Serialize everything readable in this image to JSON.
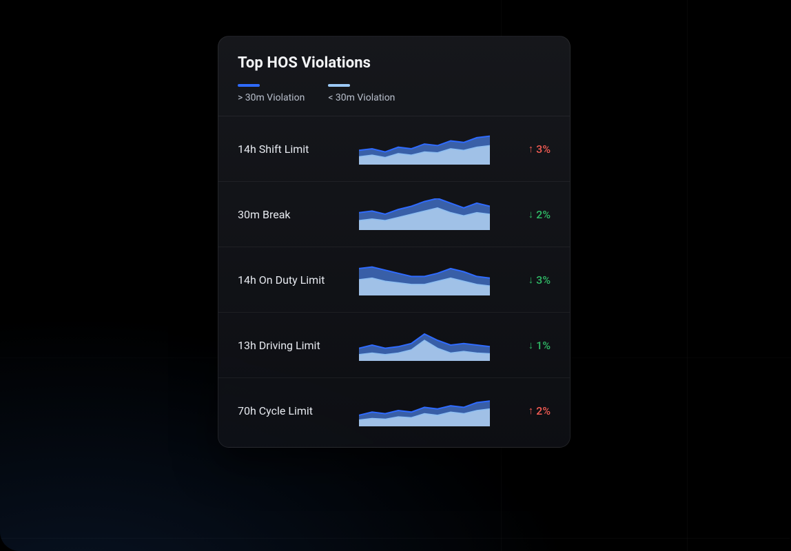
{
  "card": {
    "title": "Top HOS Violations",
    "legend": [
      {
        "swatch": "dark",
        "label": "> 30m Violation"
      },
      {
        "swatch": "light",
        "label": "< 30m Violation"
      }
    ]
  },
  "colors": {
    "series_over_30m_line": "#2f6bff",
    "series_over_30m_fill": "rgba(74,128,230,0.70)",
    "series_under_30m_line": "#8fbef0",
    "series_under_30m_fill": "rgba(190,220,248,0.78)",
    "delta_up": "#ef5a52",
    "delta_down": "#2fb765"
  },
  "rows": [
    {
      "label": "14h Shift Limit",
      "delta": {
        "dir": "up",
        "text": "3%"
      },
      "over": [
        18,
        20,
        16,
        22,
        20,
        26,
        24,
        30,
        28,
        34,
        36
      ],
      "under": [
        10,
        12,
        9,
        14,
        12,
        16,
        15,
        20,
        18,
        22,
        24
      ]
    },
    {
      "label": "30m Break",
      "delta": {
        "dir": "down",
        "text": "2%"
      },
      "over": [
        22,
        24,
        20,
        26,
        30,
        36,
        40,
        34,
        28,
        34,
        30
      ],
      "under": [
        12,
        14,
        12,
        16,
        20,
        24,
        28,
        22,
        18,
        22,
        20
      ]
    },
    {
      "label": "14h On Duty Limit",
      "delta": {
        "dir": "down",
        "text": "3%"
      },
      "over": [
        34,
        36,
        32,
        28,
        24,
        24,
        28,
        34,
        30,
        24,
        22
      ],
      "under": [
        20,
        22,
        18,
        16,
        14,
        14,
        18,
        22,
        18,
        14,
        12
      ]
    },
    {
      "label": "13h Driving Limit",
      "delta": {
        "dir": "down",
        "text": "1%"
      },
      "over": [
        16,
        20,
        16,
        18,
        22,
        34,
        26,
        20,
        22,
        20,
        18
      ],
      "under": [
        8,
        10,
        8,
        10,
        14,
        26,
        16,
        10,
        12,
        10,
        9
      ]
    },
    {
      "label": "70h Cycle Limit",
      "delta": {
        "dir": "up",
        "text": "2%"
      },
      "over": [
        14,
        18,
        16,
        20,
        18,
        24,
        22,
        26,
        24,
        30,
        32
      ],
      "under": [
        8,
        10,
        9,
        12,
        11,
        16,
        14,
        18,
        16,
        20,
        22
      ]
    }
  ],
  "chart_data": {
    "type": "area",
    "note": "Five small-multiple stacked-area sparklines; y-axes are unlabeled (relative scale, approx 0–40). Each sparkline has two series: '> 30m Violation' (darker blue, upper band) and '< 30m Violation' (lighter blue, lower band). 11 evenly spaced x points per sparkline, x-axis unlabeled.",
    "legend": [
      "> 30m Violation",
      "< 30m Violation"
    ],
    "ylim": [
      0,
      40
    ],
    "x_points": 11,
    "charts": [
      {
        "title": "14h Shift Limit",
        "delta_percent": 3,
        "delta_direction": "up",
        "series": [
          {
            "name": "> 30m Violation",
            "values": [
              18,
              20,
              16,
              22,
              20,
              26,
              24,
              30,
              28,
              34,
              36
            ]
          },
          {
            "name": "< 30m Violation",
            "values": [
              10,
              12,
              9,
              14,
              12,
              16,
              15,
              20,
              18,
              22,
              24
            ]
          }
        ]
      },
      {
        "title": "30m Break",
        "delta_percent": 2,
        "delta_direction": "down",
        "series": [
          {
            "name": "> 30m Violation",
            "values": [
              22,
              24,
              20,
              26,
              30,
              36,
              40,
              34,
              28,
              34,
              30
            ]
          },
          {
            "name": "< 30m Violation",
            "values": [
              12,
              14,
              12,
              16,
              20,
              24,
              28,
              22,
              18,
              22,
              20
            ]
          }
        ]
      },
      {
        "title": "14h On Duty Limit",
        "delta_percent": 3,
        "delta_direction": "down",
        "series": [
          {
            "name": "> 30m Violation",
            "values": [
              34,
              36,
              32,
              28,
              24,
              24,
              28,
              34,
              30,
              24,
              22
            ]
          },
          {
            "name": "< 30m Violation",
            "values": [
              20,
              22,
              18,
              16,
              14,
              14,
              18,
              22,
              18,
              14,
              12
            ]
          }
        ]
      },
      {
        "title": "13h Driving Limit",
        "delta_percent": 1,
        "delta_direction": "down",
        "series": [
          {
            "name": "> 30m Violation",
            "values": [
              16,
              20,
              16,
              18,
              22,
              34,
              26,
              20,
              22,
              20,
              18
            ]
          },
          {
            "name": "< 30m Violation",
            "values": [
              8,
              10,
              8,
              10,
              14,
              26,
              16,
              10,
              12,
              10,
              9
            ]
          }
        ]
      },
      {
        "title": "70h Cycle Limit",
        "delta_percent": 2,
        "delta_direction": "up",
        "series": [
          {
            "name": "> 30m Violation",
            "values": [
              14,
              18,
              16,
              20,
              18,
              24,
              22,
              26,
              24,
              30,
              32
            ]
          },
          {
            "name": "< 30m Violation",
            "values": [
              8,
              10,
              9,
              12,
              11,
              16,
              14,
              18,
              16,
              20,
              22
            ]
          }
        ]
      }
    ]
  }
}
